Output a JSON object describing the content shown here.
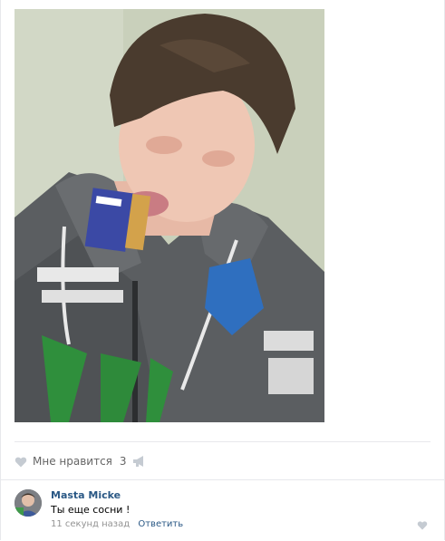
{
  "post": {
    "photo_icon": "photo",
    "likes": {
      "label": "Мне нравится",
      "count": "3",
      "icon": "heart-icon"
    },
    "share": {
      "icon": "megaphone-icon"
    }
  },
  "comment": {
    "author": "Masta Micke",
    "text": "Ты еще сосни !",
    "time": "11 секунд назад",
    "reply_label": "Ответить",
    "like_icon": "heart-icon"
  },
  "colors": {
    "link": "#2a5885",
    "muted": "#939393",
    "icon": "#c5cbd2",
    "divider": "#e7e8ec"
  }
}
